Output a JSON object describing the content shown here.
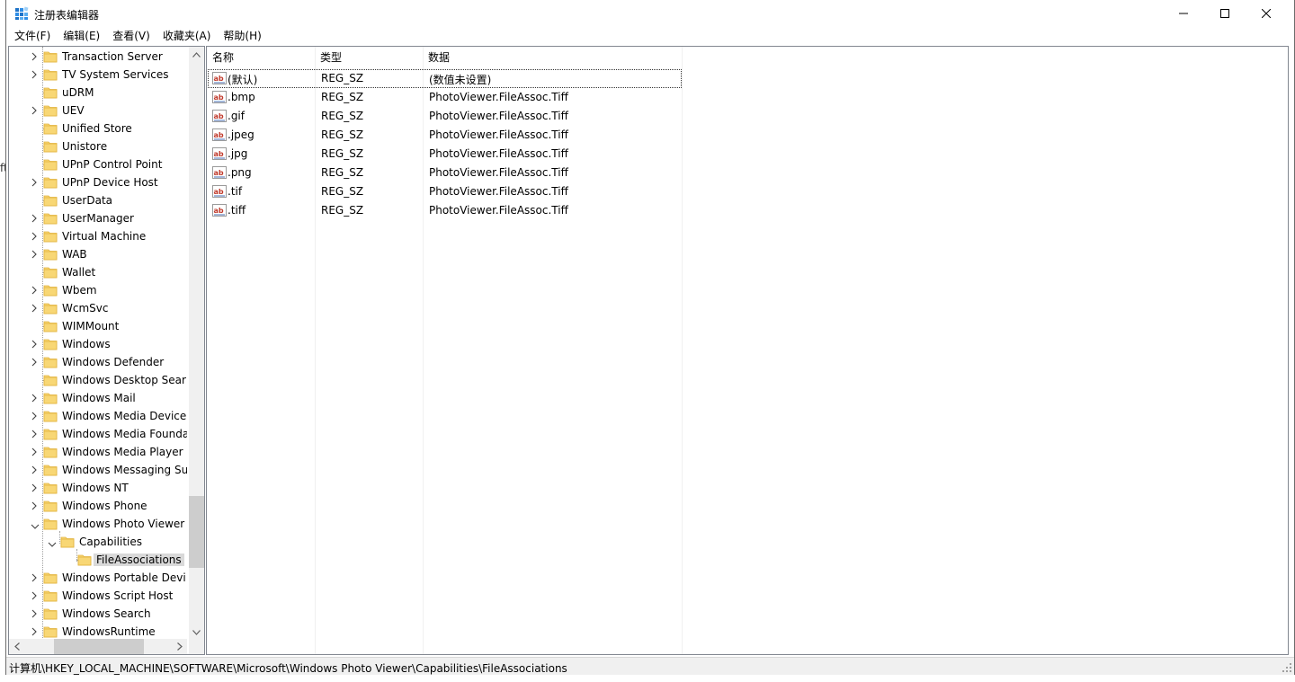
{
  "window": {
    "title": "注册表编辑器"
  },
  "menu": [
    "文件(F)",
    "编辑(E)",
    "查看(V)",
    "收藏夹(A)",
    "帮助(H)"
  ],
  "tree": {
    "items": [
      {
        "label": "Transaction Server",
        "level": 0,
        "expandable": true
      },
      {
        "label": "TV System Services",
        "level": 0,
        "expandable": true
      },
      {
        "label": "uDRM",
        "level": 0,
        "expandable": false
      },
      {
        "label": "UEV",
        "level": 0,
        "expandable": true
      },
      {
        "label": "Unified Store",
        "level": 0,
        "expandable": false
      },
      {
        "label": "Unistore",
        "level": 0,
        "expandable": false
      },
      {
        "label": "UPnP Control Point",
        "level": 0,
        "expandable": false
      },
      {
        "label": "UPnP Device Host",
        "level": 0,
        "expandable": true
      },
      {
        "label": "UserData",
        "level": 0,
        "expandable": false
      },
      {
        "label": "UserManager",
        "level": 0,
        "expandable": true
      },
      {
        "label": "Virtual Machine",
        "level": 0,
        "expandable": true
      },
      {
        "label": "WAB",
        "level": 0,
        "expandable": true
      },
      {
        "label": "Wallet",
        "level": 0,
        "expandable": false
      },
      {
        "label": "Wbem",
        "level": 0,
        "expandable": true
      },
      {
        "label": "WcmSvc",
        "level": 0,
        "expandable": true
      },
      {
        "label": "WIMMount",
        "level": 0,
        "expandable": false
      },
      {
        "label": "Windows",
        "level": 0,
        "expandable": true
      },
      {
        "label": "Windows Defender",
        "level": 0,
        "expandable": true
      },
      {
        "label": "Windows Desktop Sear",
        "level": 0,
        "expandable": false
      },
      {
        "label": "Windows Mail",
        "level": 0,
        "expandable": true
      },
      {
        "label": "Windows Media Device",
        "level": 0,
        "expandable": true
      },
      {
        "label": "Windows Media Founda",
        "level": 0,
        "expandable": true
      },
      {
        "label": "Windows Media Player",
        "level": 0,
        "expandable": true
      },
      {
        "label": "Windows Messaging Su",
        "level": 0,
        "expandable": true
      },
      {
        "label": "Windows NT",
        "level": 0,
        "expandable": true
      },
      {
        "label": "Windows Phone",
        "level": 0,
        "expandable": true
      },
      {
        "label": "Windows Photo Viewer",
        "level": 0,
        "expandable": true,
        "expanded": true
      },
      {
        "label": "Capabilities",
        "level": 1,
        "expandable": true,
        "expanded": true
      },
      {
        "label": "FileAssociations",
        "level": 2,
        "expandable": false,
        "selected": true
      },
      {
        "label": "Windows Portable Devi",
        "level": 0,
        "expandable": true
      },
      {
        "label": "Windows Script Host",
        "level": 0,
        "expandable": true
      },
      {
        "label": "Windows Search",
        "level": 0,
        "expandable": true
      },
      {
        "label": "WindowsRuntime",
        "level": 0,
        "expandable": true
      }
    ]
  },
  "list": {
    "columns": {
      "name": "名称",
      "type": "类型",
      "data": "数据"
    },
    "rows": [
      {
        "name": "(默认)",
        "type": "REG_SZ",
        "data": "(数值未设置)"
      },
      {
        "name": ".bmp",
        "type": "REG_SZ",
        "data": "PhotoViewer.FileAssoc.Tiff"
      },
      {
        "name": ".gif",
        "type": "REG_SZ",
        "data": "PhotoViewer.FileAssoc.Tiff"
      },
      {
        "name": ".jpeg",
        "type": "REG_SZ",
        "data": "PhotoViewer.FileAssoc.Tiff"
      },
      {
        "name": ".jpg",
        "type": "REG_SZ",
        "data": "PhotoViewer.FileAssoc.Tiff"
      },
      {
        "name": ".png",
        "type": "REG_SZ",
        "data": "PhotoViewer.FileAssoc.Tiff"
      },
      {
        "name": ".tif",
        "type": "REG_SZ",
        "data": "PhotoViewer.FileAssoc.Tiff"
      },
      {
        "name": ".tiff",
        "type": "REG_SZ",
        "data": "PhotoViewer.FileAssoc.Tiff"
      }
    ]
  },
  "status": {
    "path": "计算机\\HKEY_LOCAL_MACHINE\\SOFTWARE\\Microsoft\\Windows Photo Viewer\\Capabilities\\FileAssociations"
  },
  "colors": {
    "folder": "#f8d775",
    "folder_edge": "#e2b33c",
    "selection": "#d9d9d9",
    "ab_red": "#c0392b"
  }
}
